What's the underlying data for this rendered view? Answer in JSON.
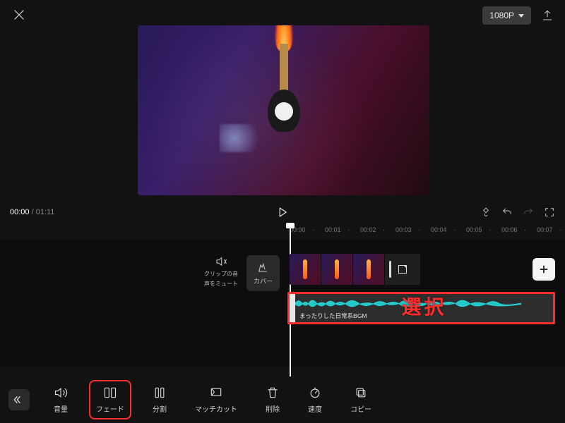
{
  "header": {
    "resolution_label": "1080P"
  },
  "transport": {
    "current_time": "00:00",
    "total_time": "01:11"
  },
  "ruler": [
    "00:00",
    "00:01",
    "00:02",
    "00:03",
    "00:04",
    "00:05",
    "00:06",
    "00:07"
  ],
  "timeline": {
    "mute_label_line1": "クリップの音",
    "mute_label_line2": "声をミュート",
    "cover_label": "カバー",
    "audio_clip_title": "まったりした日常系BGM",
    "selection_overlay": "選択"
  },
  "toolbar": [
    {
      "id": "volume",
      "label": "音量"
    },
    {
      "id": "fade",
      "label": "フェード",
      "highlighted": true
    },
    {
      "id": "split",
      "label": "分割"
    },
    {
      "id": "matchcut",
      "label": "マッチカット"
    },
    {
      "id": "delete",
      "label": "削除"
    },
    {
      "id": "speed",
      "label": "速度"
    },
    {
      "id": "copy",
      "label": "コピー"
    }
  ]
}
